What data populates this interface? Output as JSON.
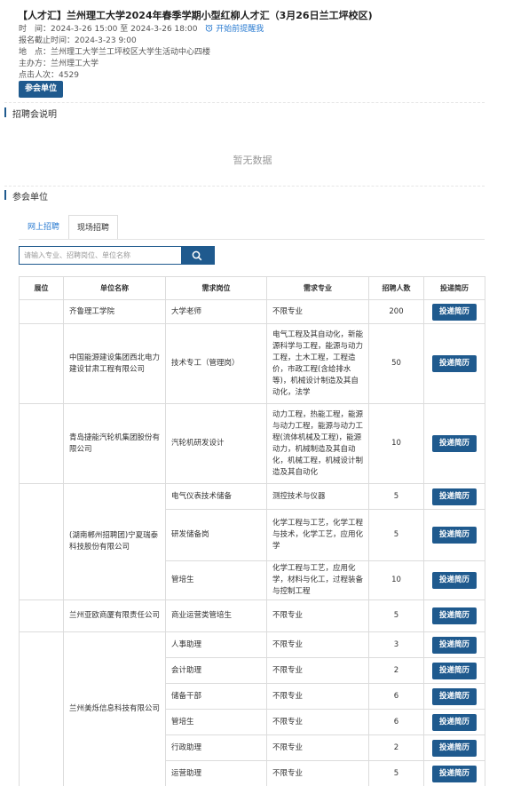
{
  "header": {
    "title": "【人才汇】兰州理工大学2024年春季学期小型红柳人才汇（3月26日兰工坪校区)",
    "time_label": "时　间：",
    "time_value": "2024-3-26 15:00 至 2024-3-26 18:00",
    "remind_label": "开始前提醒我",
    "deadline_label": "报名截止时间：",
    "deadline_value": "2024-3-23 9:00",
    "place_label": "地　点：",
    "place_value": "兰州理工大学兰工坪校区大学生活动中心四楼",
    "host_label": "主办方：",
    "host_value": "兰州理工大学",
    "clicks_label": "点击人次：",
    "clicks_value": "4529",
    "join_button": "参会单位"
  },
  "sections": {
    "recruit_desc": "招聘会说明",
    "no_data": "暂无数据",
    "participants": "参会单位"
  },
  "tabs": [
    {
      "label": "网上招聘"
    },
    {
      "label": "现场招聘"
    }
  ],
  "search": {
    "placeholder": "请输入专业、招聘岗位、单位名称"
  },
  "table": {
    "headers": [
      "展位",
      "单位名称",
      "需求岗位",
      "需求专业",
      "招聘人数",
      "投递简历"
    ],
    "apply_label": "投递简历",
    "companies": [
      {
        "name": "齐鲁理工学院",
        "positions": [
          {
            "post": "大学老师",
            "major": "不限专业",
            "count": "200"
          }
        ]
      },
      {
        "name": "中国能源建设集团西北电力建设甘肃工程有限公司",
        "positions": [
          {
            "post": "技术专工（管理岗）",
            "major": "电气工程及其自动化，新能源科学与工程，能源与动力工程，土木工程，工程造价，市政工程(含给排水等)，机械设计制造及其自动化，法学",
            "count": "50"
          }
        ]
      },
      {
        "name": "青岛捷能汽轮机集团股份有限公司",
        "positions": [
          {
            "post": "汽轮机研发设计",
            "major": "动力工程，热能工程，能源与动力工程，能源与动力工程(流体机械及工程)，能源动力，机械制造及其自动化，机械工程，机械设计制造及其自动化",
            "count": "10"
          }
        ]
      },
      {
        "name": "(湖南郴州招聘团)宁夏瑞泰科技股份有限公司",
        "positions": [
          {
            "post": "电气仪表技术储备",
            "major": "测控技术与仪器",
            "count": "5"
          },
          {
            "post": "研发储备岗",
            "major": "化学工程与工艺，化学工程与技术，化学工艺，应用化学",
            "count": "5"
          },
          {
            "post": "管培生",
            "major": "化学工程与工艺，应用化学，材料与化工，过程装备与控制工程",
            "count": "10"
          }
        ]
      },
      {
        "name": "兰州亚欧商厦有限责任公司",
        "positions": [
          {
            "post": "商业运营类管培生",
            "major": "不限专业",
            "count": "5"
          }
        ]
      },
      {
        "name": "兰州美烁信息科技有限公司",
        "positions": [
          {
            "post": "人事助理",
            "major": "不限专业",
            "count": "3"
          },
          {
            "post": "会计助理",
            "major": "不限专业",
            "count": "2"
          },
          {
            "post": "储备干部",
            "major": "不限专业",
            "count": "6"
          },
          {
            "post": "管培生",
            "major": "不限专业",
            "count": "6"
          },
          {
            "post": "行政助理",
            "major": "不限专业",
            "count": "2"
          },
          {
            "post": "运营助理",
            "major": "不限专业",
            "count": "5"
          }
        ]
      }
    ]
  },
  "colors": {
    "accent": "#1f5a8e",
    "link": "#2a7bd1"
  }
}
